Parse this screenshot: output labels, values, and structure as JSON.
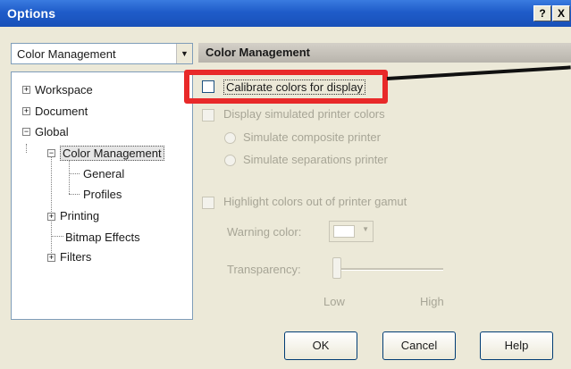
{
  "window": {
    "title": "Options",
    "help_button": "?",
    "close_button": "X"
  },
  "category_select": {
    "value": "Color Management"
  },
  "tree": {
    "workspace": "Workspace",
    "document": "Document",
    "global": "Global",
    "color_management": "Color Management",
    "general": "General",
    "profiles": "Profiles",
    "printing": "Printing",
    "bitmap_effects": "Bitmap Effects",
    "filters": "Filters"
  },
  "panel": {
    "title": "Color Management",
    "calibrate_label": "Calibrate colors for display",
    "display_simulated_label": "Display simulated printer colors",
    "simulate_composite_label": "Simulate composite printer",
    "simulate_separations_label": "Simulate separations printer",
    "highlight_label": "Highlight colors out of printer gamut",
    "warning_color_label": "Warning color:",
    "transparency_label": "Transparency:",
    "slider_low": "Low",
    "slider_high": "High",
    "transparency_level": 0
  },
  "buttons": {
    "ok": "OK",
    "cancel": "Cancel",
    "help": "Help"
  },
  "colors": {
    "titlebar": "#1f5cc9",
    "highlight": "#e82929"
  }
}
